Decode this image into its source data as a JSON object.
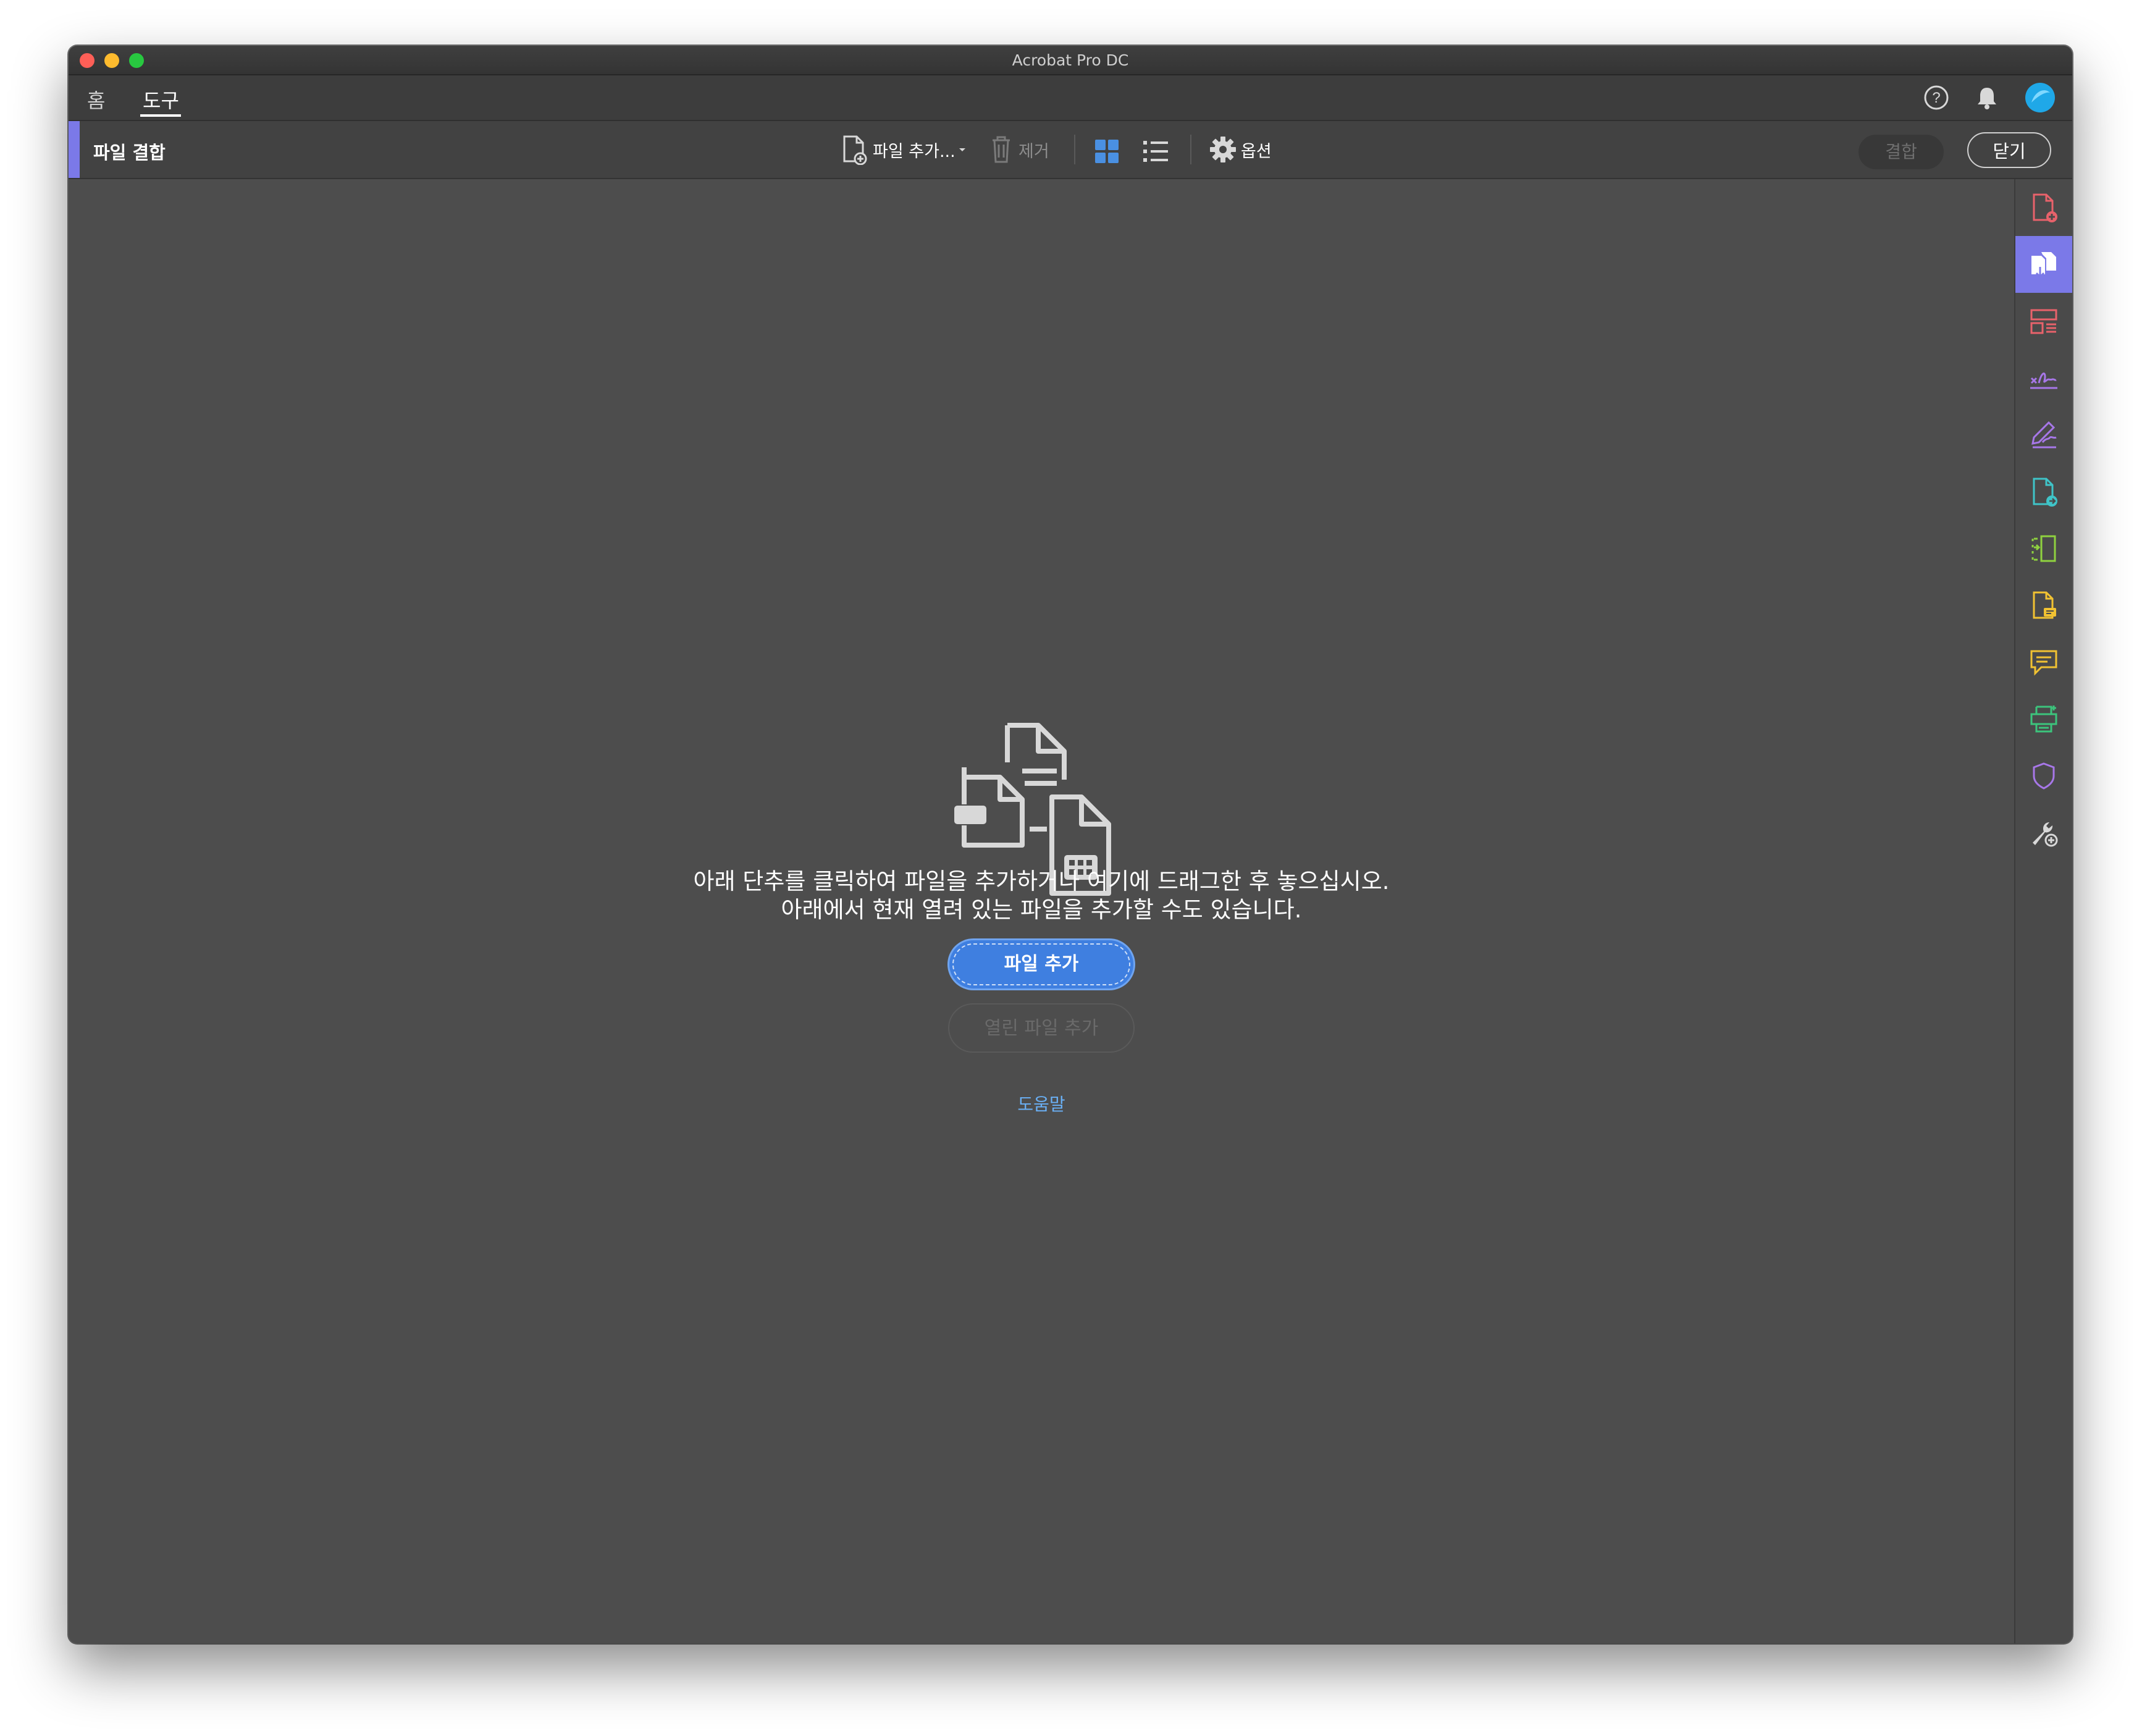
{
  "window": {
    "title": "Acrobat Pro DC"
  },
  "tabs": [
    {
      "label": "홈"
    },
    {
      "label": "도구"
    }
  ],
  "toolbar": {
    "title": "파일 결합",
    "add_files": "파일 추가...",
    "remove": "제거",
    "options": "옵션",
    "combine": "결합",
    "close": "닫기"
  },
  "main": {
    "message_line1": "아래 단추를 클릭하여 파일을 추가하거나 여기에 드래그한 후 놓으십시오.",
    "message_line2": "아래에서 현재 열려 있는 파일을 추가할 수도 있습니다.",
    "add_file_button": "파일 추가",
    "add_open_files_button": "열린 파일 추가",
    "help_link": "도움말"
  },
  "colors": {
    "accent": "#7b79e8",
    "primary_button": "#3f7fe0",
    "link": "#6ab0f5",
    "background": "#4d4d4d"
  },
  "sidebar": {
    "items": [
      {
        "icon": "create-pdf-icon",
        "color": "#e8626b"
      },
      {
        "icon": "combine-files-icon",
        "color": "#ffffff",
        "active": true
      },
      {
        "icon": "organize-pages-icon",
        "color": "#e8626b"
      },
      {
        "icon": "fill-sign-icon",
        "color": "#a777e8"
      },
      {
        "icon": "request-signature-icon",
        "color": "#a777e8"
      },
      {
        "icon": "export-pdf-icon",
        "color": "#3fc4c8"
      },
      {
        "icon": "edit-pdf-icon",
        "color": "#8fd13f"
      },
      {
        "icon": "comment-file-icon",
        "color": "#f1c232"
      },
      {
        "icon": "comment-icon",
        "color": "#f1c232"
      },
      {
        "icon": "scan-ocr-icon",
        "color": "#3cc47c"
      },
      {
        "icon": "protect-icon",
        "color": "#a777e8"
      },
      {
        "icon": "more-tools-icon",
        "color": "#d8d8d8"
      }
    ]
  }
}
